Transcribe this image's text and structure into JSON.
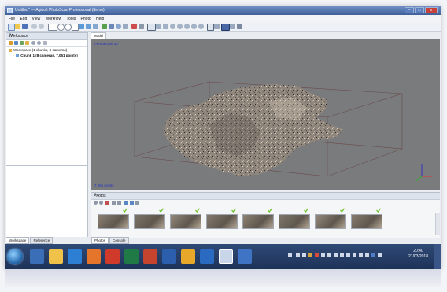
{
  "window": {
    "title": "Untitled* — Agisoft PhotoScan Professional (demo)",
    "buttons": {
      "minimize": "–",
      "maximize": "□",
      "close": "x"
    }
  },
  "menu": [
    "File",
    "Edit",
    "View",
    "Workflow",
    "Tools",
    "Photo",
    "Help"
  ],
  "workspace": {
    "title": "Workspace",
    "dock": "# x",
    "root": "Workspace (1 chunks, 8 cameras)",
    "chunk": "Chunk 1 (8 cameras, 7,061 points)",
    "tabs": [
      "Workspace",
      "Reference"
    ]
  },
  "model": {
    "tab": "Model",
    "view_label": "Perspective 30°",
    "points_label": "7,061 points"
  },
  "photos": {
    "title": "Photos",
    "dock": "# x",
    "thumb_count": 8,
    "tabs": [
      "Photos",
      "Console"
    ]
  },
  "taskbar": {
    "time": "20:40",
    "date": "21/03/2018",
    "apps": [
      "explorer-icon",
      "file-explorer-icon",
      "internet-explorer-icon",
      "firefox-icon",
      "office-icon",
      "excel-icon",
      "powerpoint-icon",
      "word-icon",
      "chrome-icon",
      "outlook-icon",
      "photoscan-icon",
      "another-icon"
    ]
  },
  "colors": {
    "titlebar": "#4a69a6",
    "viewport": "#7a7b7d",
    "label_blue": "#2431c4",
    "check_green": "#6ec229",
    "taskbar": "#26406b"
  }
}
